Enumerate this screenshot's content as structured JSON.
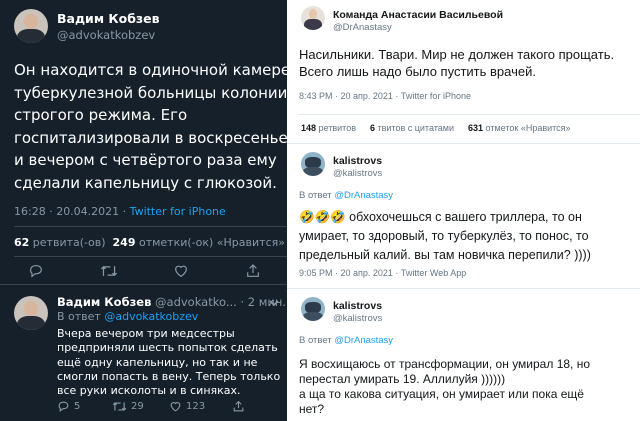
{
  "left_panel": {
    "main_tweet": {
      "author_name": "Вадим Кобзев",
      "author_handle": "@advokatkobzev",
      "text_lines": [
        "Он находится в одиночной камере",
        "туберкулезной больницы колонии",
        "строгого режима. Его",
        "госпитализировали в воскресенье",
        "и вечером с четвёртого раза ему",
        "сделали капельницу с глюкозой."
      ],
      "timestamp": "16:28 · 20.04.2021 · ",
      "source": "Twitter for iPhone",
      "retweets_count": "62",
      "retweets_label": " ретвита(-ов)  ",
      "likes_count": "249",
      "likes_label": " отметки(-ок) «Нравится»"
    },
    "reply_tweet": {
      "author_name": "Вадим Кобзев",
      "author_handle": "@advokatko... · 2 мин.",
      "reply_prefix": "В ответ ",
      "reply_to": "@advokatkobzev",
      "text_lines": [
        "Вчера вечером три медсестры",
        "предприняли шесть попыток сделать",
        "ещё одну капельницу, но так и не",
        "смогли попасть в вену. Теперь только",
        "все руки исколоты и в синяках."
      ],
      "reply_count": "5",
      "retweet_count": "29",
      "like_count": "123"
    }
  },
  "right_panel": {
    "tweet1": {
      "author_name": "Команда Анастасии Васильевой",
      "author_handle": "@DrAnastasy",
      "text_lines": [
        "Насильники. Твари. Мир не должен такого прощать.",
        "Всего лишь надо было пустить врачей."
      ],
      "timestamp": "8:43 PM · 20 апр. 2021 · Twitter for iPhone",
      "retweets_count": "148",
      "retweets_label": " ретвитов",
      "quotes_count": "6",
      "quotes_label": " твитов с цитатами",
      "likes_count": "631",
      "likes_label": " отметок «Нравится»"
    },
    "tweet2": {
      "author_name": "kalistrovs",
      "author_handle": "@kalistrovs",
      "reply_prefix": "В ответ ",
      "reply_to": "@DrAnastasy",
      "emoji": "🤣🤣🤣",
      "text_lines": [
        " обхохочешься с вашего триллера, то он",
        "умирает, то здоровый, то туберкулёз, то понос, то",
        "предельный калий. вы там новичка перепили? ))))"
      ],
      "timestamp": "9:05 PM · 20 апр. 2021 · Twitter Web App"
    },
    "tweet3": {
      "author_name": "kalistrovs",
      "author_handle": "@kalistrovs",
      "reply_prefix": "В ответ ",
      "reply_to": "@DrAnastasy",
      "text_lines": [
        "Я восхищаюсь от трансформации, он умирал 18, но",
        "перестал умирать 19. Аллилуйя ))))))",
        "а ща то какова ситуация, он умирает или пока ещё",
        "нет?"
      ]
    }
  },
  "colors": {
    "dark_bg": "#15202b",
    "dark_muted": "#8899a6",
    "twitter_blue": "#1da1f2",
    "light_bg": "#ffffff",
    "light_muted": "#657786"
  },
  "icons": [
    "reply-icon",
    "retweet-icon",
    "like-icon",
    "share-icon",
    "chevron-down-icon"
  ]
}
